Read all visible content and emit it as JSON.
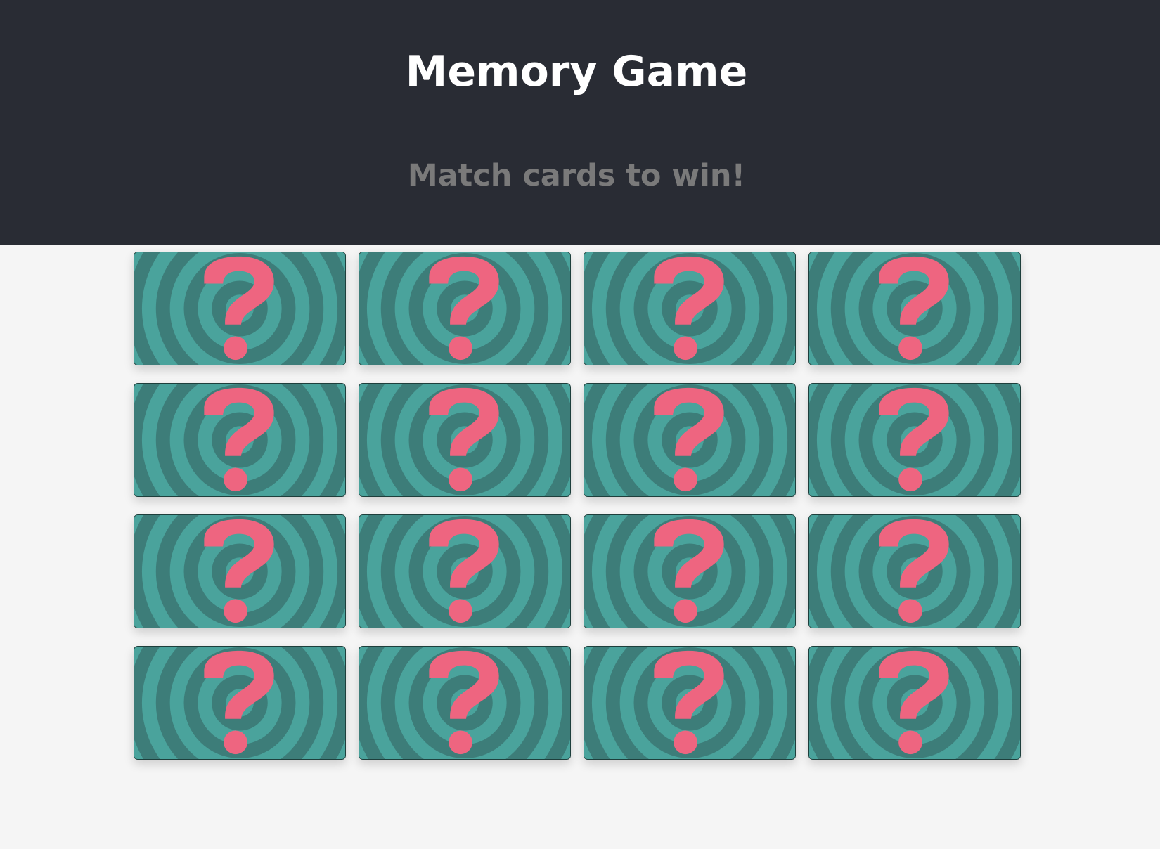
{
  "header": {
    "title": "Memory Game",
    "subtitle": "Match cards to win!"
  },
  "colors": {
    "header_bg": "#292c34",
    "page_bg": "#f5f5f5",
    "card_ring_light": "#4aa39c",
    "card_ring_dark": "#3d7d79",
    "question_mark": "#ee6580",
    "subtitle_text": "#7a7a7a"
  },
  "board": {
    "rows": 4,
    "columns": 4,
    "cards": [
      {
        "face": "hidden",
        "icon": "question-mark-icon"
      },
      {
        "face": "hidden",
        "icon": "question-mark-icon"
      },
      {
        "face": "hidden",
        "icon": "question-mark-icon"
      },
      {
        "face": "hidden",
        "icon": "question-mark-icon"
      },
      {
        "face": "hidden",
        "icon": "question-mark-icon"
      },
      {
        "face": "hidden",
        "icon": "question-mark-icon"
      },
      {
        "face": "hidden",
        "icon": "question-mark-icon"
      },
      {
        "face": "hidden",
        "icon": "question-mark-icon"
      },
      {
        "face": "hidden",
        "icon": "question-mark-icon"
      },
      {
        "face": "hidden",
        "icon": "question-mark-icon"
      },
      {
        "face": "hidden",
        "icon": "question-mark-icon"
      },
      {
        "face": "hidden",
        "icon": "question-mark-icon"
      },
      {
        "face": "hidden",
        "icon": "question-mark-icon"
      },
      {
        "face": "hidden",
        "icon": "question-mark-icon"
      },
      {
        "face": "hidden",
        "icon": "question-mark-icon"
      },
      {
        "face": "hidden",
        "icon": "question-mark-icon"
      }
    ]
  }
}
